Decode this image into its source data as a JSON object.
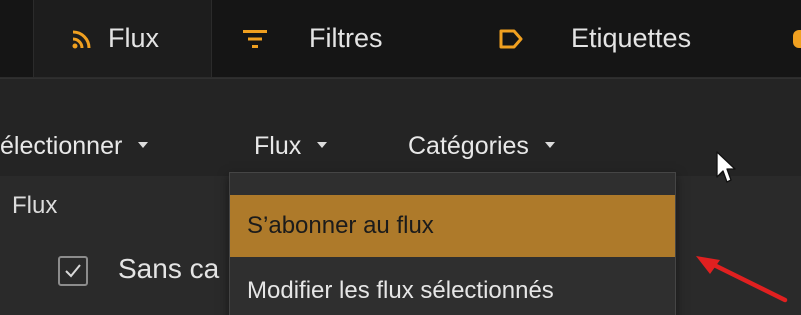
{
  "tabs": [
    {
      "label": "Flux",
      "icon": "rss-icon",
      "active": true
    },
    {
      "label": "Filtres",
      "icon": "filter-icon",
      "active": false
    },
    {
      "label": "Etiquettes",
      "icon": "tag-icon",
      "active": false
    }
  ],
  "menubar": {
    "items": [
      {
        "label": "électionner"
      },
      {
        "label": "Flux"
      },
      {
        "label": "Catégories"
      }
    ]
  },
  "content": {
    "section_label": "Flux",
    "row_label": "Sans ca"
  },
  "dropdown": {
    "items": [
      {
        "label": "S’abonner au flux",
        "highlighted": true
      },
      {
        "label": "Modifier les flux sélectionnés",
        "highlighted": false
      }
    ]
  },
  "colors": {
    "accent": "#f0a020",
    "highlight": "#ae7a2a",
    "annotation_arrow": "#e02020"
  }
}
